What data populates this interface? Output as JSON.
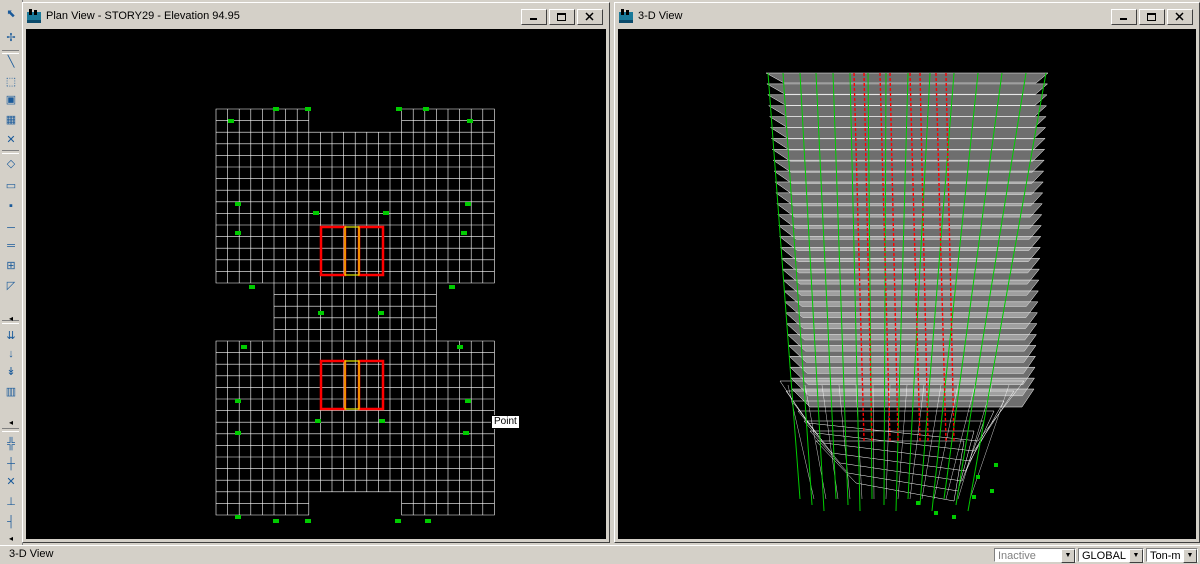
{
  "toolbar": {
    "tools": [
      {
        "name": "select-pointer-icon",
        "glyph": "⬉"
      },
      {
        "name": "reshape-pointer-icon",
        "glyph": "✢"
      },
      {
        "name": "draw-line-icon",
        "glyph": "╲"
      },
      {
        "name": "select-window-icon",
        "glyph": "⬚"
      },
      {
        "name": "select-intersect-icon",
        "glyph": "▣"
      },
      {
        "name": "select-all-icon",
        "glyph": "▦"
      },
      {
        "name": "deselect-icon",
        "glyph": "✕"
      },
      {
        "name": "draw-area-icon",
        "glyph": "◇"
      },
      {
        "name": "draw-rect-area-icon",
        "glyph": "▭"
      },
      {
        "name": "draw-point-icon",
        "glyph": "▪"
      },
      {
        "name": "draw-beam-icon",
        "glyph": "─"
      },
      {
        "name": "draw-wall-icon",
        "glyph": "═"
      },
      {
        "name": "grid-icon",
        "glyph": "⊞"
      },
      {
        "name": "draw-brace-icon",
        "glyph": "◸"
      },
      {
        "name": "assign-loads-icon",
        "glyph": "⇊"
      },
      {
        "name": "point-load-icon",
        "glyph": "↓"
      },
      {
        "name": "frame-load-icon",
        "glyph": "↡"
      },
      {
        "name": "area-load-icon",
        "glyph": "▥"
      },
      {
        "name": "snap-points-icon",
        "glyph": "╬"
      },
      {
        "name": "snap-ends-icon",
        "glyph": "┼"
      },
      {
        "name": "snap-intersect-icon",
        "glyph": "✕"
      },
      {
        "name": "snap-perp-icon",
        "glyph": "⊥"
      },
      {
        "name": "snap-lines-icon",
        "glyph": "┤"
      }
    ]
  },
  "windows": {
    "plan": {
      "title": "Plan View - STORY29 - Elevation 94.95"
    },
    "view3d": {
      "title": "3-D View"
    }
  },
  "tooltip": {
    "text": "Point"
  },
  "statusbar": {
    "active_view": "3-D View",
    "status_value": "Inactive",
    "coord_system": "GLOBAL",
    "units": "Ton-m"
  },
  "colors": {
    "background": "#000000",
    "grid_line": "#ffffff",
    "core_wall": "#ff0000",
    "support": "#00cc00",
    "floor_slab": "#c8c8c8",
    "yellow_link": "#e8e800",
    "chrome": "#d4d0c8"
  }
}
